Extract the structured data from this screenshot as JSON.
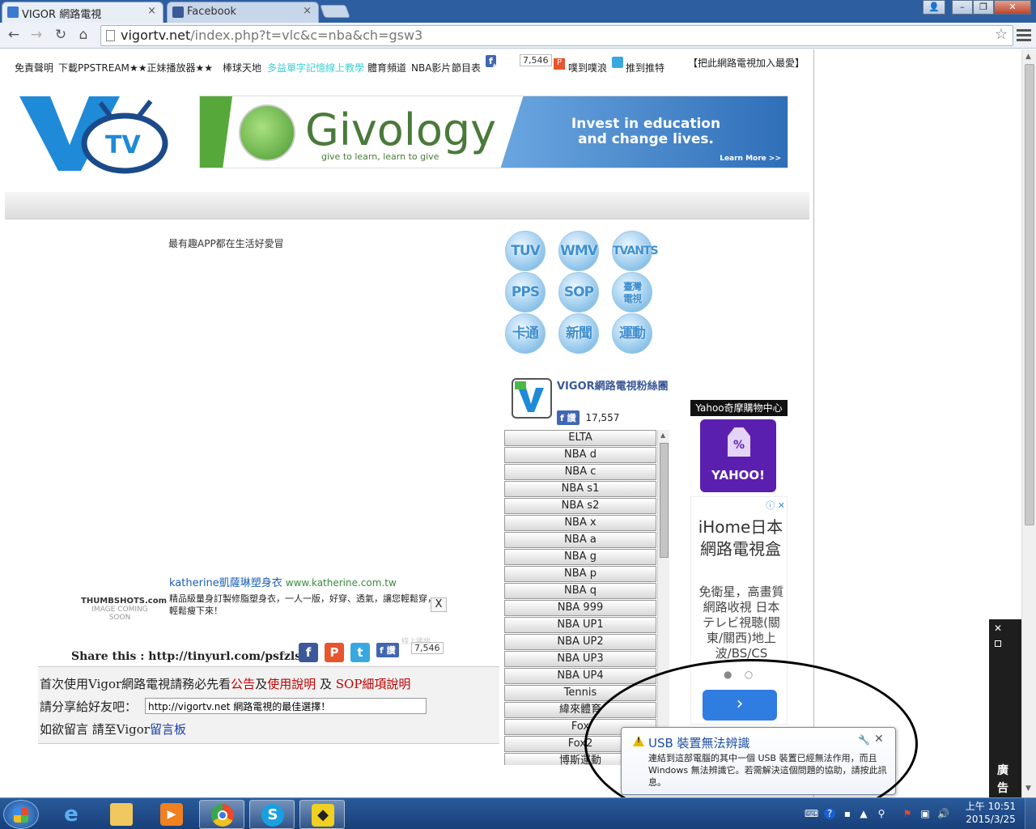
{
  "browser": {
    "tabs": [
      {
        "label": "VIGOR 網路電視",
        "close": "×"
      },
      {
        "label": "Facebook",
        "close": "×"
      }
    ],
    "address": {
      "host": "vigortv.net",
      "path": "/index.php?t=vlc&c=nba&ch=gsw3"
    },
    "icons": {
      "back": "back-arrow-icon",
      "forward": "forward-arrow-icon",
      "reload": "reload-icon",
      "home": "home-icon",
      "bookmark": "star-icon",
      "menu": "hamburger-menu-icon"
    }
  },
  "site": {
    "topnav": {
      "items": [
        "免責聲明",
        "下載PPSTREAM",
        "★★正妹播放器★★",
        "棒球天地",
        "多益單字記憶線上教學",
        "體育頻道",
        "NBA影片",
        "節目表"
      ],
      "like_label": "讚",
      "like_count": "7,546",
      "plurk_label": "噗到噗浪",
      "twitter_label": "推到推特",
      "bookmark_label": "【把此網路電視加入最愛】"
    },
    "logo_text": "TV",
    "banner": {
      "brand": "Givology",
      "tagline": "give to learn, learn to give",
      "slogan_line1": "Invest in education",
      "slogan_line2": "and change lives.",
      "cta": "Learn More >>"
    },
    "promo_text": "最有趣APP都在生活好愛冒",
    "channel_buttons": [
      "TUV",
      "WMV",
      "TVANTS",
      "PPS",
      "SOP",
      "臺灣電視",
      "卡通",
      "新聞",
      "運動"
    ],
    "fanbox": {
      "title": "VIGOR網路電視粉絲團",
      "like_label": "讚",
      "count": "17,557"
    },
    "channels": [
      "ELTA",
      "NBA d",
      "NBA c",
      "NBA s1",
      "NBA s2",
      "NBA x",
      "NBA a",
      "NBA g",
      "NBA p",
      "NBA q",
      "NBA 999",
      "NBA UP1",
      "NBA UP2",
      "NBA UP3",
      "NBA UP4",
      "Tennis",
      "緯來體育",
      "Fox",
      "Fox2",
      "博斯運動"
    ],
    "thumbshots": {
      "brand": "THUMBSHOTS.com",
      "sub": "IMAGE COMING SOON"
    },
    "text_ad": {
      "title": "katherine凱薩琳塑身衣",
      "url": "www.katherine.com.tw",
      "desc": "精品級量身訂製修脂塑身衣，一人一版，好穿、透氣，讓您輕鬆穿，輕鬆瘦下來！",
      "close": "X"
    },
    "share": {
      "label": "Share this : http://tinyurl.com/psfzlsf",
      "like_label": "讚",
      "like_count": "7,546",
      "small_caption": "線上播放"
    },
    "info": {
      "line1_pre": "首次使用Vigor網路電視請務必先看",
      "line1_link1": "公告",
      "line1_mid": "及",
      "line1_link2": "使用說明",
      "line1_mid2": " 及 ",
      "line1_link3": "SOP細項說明",
      "line2_label": "請分享給好友吧：",
      "share_input_value": "http://vigortv.net 網路電視的最佳選擇！",
      "line3_pre": "如欲留言 請至Vigor",
      "line3_link": "留言板"
    }
  },
  "ads": {
    "yahoo": {
      "header": "Yahoo奇摩購物中心",
      "brand": "YAHOO!",
      "icon_text": "%"
    },
    "ihome": {
      "title": "iHome日本網路電視盒",
      "desc": "免衛星，高畫質網路收視 日本テレビ視聴(關東/關西)地上波/BS/CS",
      "next": "›",
      "info": "ⓘ ✕"
    },
    "side_label": "廣告",
    "side_close": "✕"
  },
  "notification": {
    "title": "USB 裝置無法辨識",
    "body": "連結到這部電腦的其中一個 USB 裝置已經無法作用，而且 Windows 無法辨識它。若需解決這個問題的協助，請按此訊息。",
    "close": "✕",
    "tool": "🔧"
  },
  "taskbar": {
    "apps": [
      "internet-explorer-icon",
      "file-explorer-icon",
      "media-player-icon",
      "chrome-icon",
      "skype-icon",
      "app-icon"
    ],
    "clock_time": "上午 10:51",
    "clock_date": "2015/3/25"
  },
  "colors": {
    "accent": "#2d5fa0",
    "fb": "#4267b2",
    "link_red": "#c00000",
    "link_blue": "#1a3fa8"
  }
}
